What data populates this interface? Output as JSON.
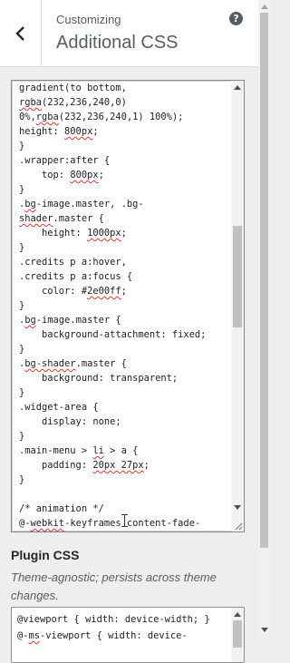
{
  "header": {
    "eyebrow": "Customizing",
    "title": "Additional CSS",
    "help_glyph": "?",
    "back_icon": "chevron-left-icon",
    "help_icon": "help-icon"
  },
  "css_editor": {
    "lines": [
      {
        "t": "gradient(to bottom,"
      },
      {
        "t": "rgba(232,236,240,0)",
        "sq": "rgba"
      },
      {
        "t": "0%,rgba(232,236,240,1) 100%);",
        "sq": "rgba"
      },
      {
        "t": "height: 800px;",
        "sq": "800px"
      },
      {
        "t": "}"
      },
      {
        "t": ".wrapper:after {"
      },
      {
        "t": "    top: 800px;",
        "sq": "800px"
      },
      {
        "t": "}"
      },
      {
        "t": ".bg-image.master, .bg-",
        "sq": "bg"
      },
      {
        "t": "shader.master {",
        "sq": "shader"
      },
      {
        "t": "    height: 1000px;",
        "sq": "1000px"
      },
      {
        "t": "}"
      },
      {
        "t": ".credits p a:hover,"
      },
      {
        "t": ".credits p a:focus {"
      },
      {
        "t": "    color: #2e00ff;",
        "sq": "2e00ff"
      },
      {
        "t": "}"
      },
      {
        "t": ".bg-image.master {",
        "sq": "bg"
      },
      {
        "t": "    background-attachment: fixed;"
      },
      {
        "t": "}"
      },
      {
        "t": ".bg-shader.master {",
        "sq": "bg-shader"
      },
      {
        "t": "    background: transparent;"
      },
      {
        "t": "}"
      },
      {
        "t": ".widget-area {"
      },
      {
        "t": "    display: none;"
      },
      {
        "t": "}"
      },
      {
        "t": ".main-menu > li > a {",
        "sq": "li"
      },
      {
        "t": "    padding: 20px 27px;",
        "sq": "20px 27px"
      },
      {
        "t": "}"
      },
      {
        "t": ""
      },
      {
        "t": "/* animation */"
      },
      {
        "t": "@-webkit-keyframes content-fade-",
        "sq": "webkit"
      }
    ]
  },
  "plugin_css": {
    "title": "Plugin CSS",
    "description": "Theme-agnostic; persists across theme changes.",
    "lines": [
      {
        "t": "@viewport { width: device-width; }"
      },
      {
        "t": "@-ms-viewport { width: device-",
        "sq": "ms"
      }
    ]
  },
  "colors": {
    "accent": "#555d66",
    "error_underline": "#d63638",
    "editor_border": "#7e8993"
  }
}
